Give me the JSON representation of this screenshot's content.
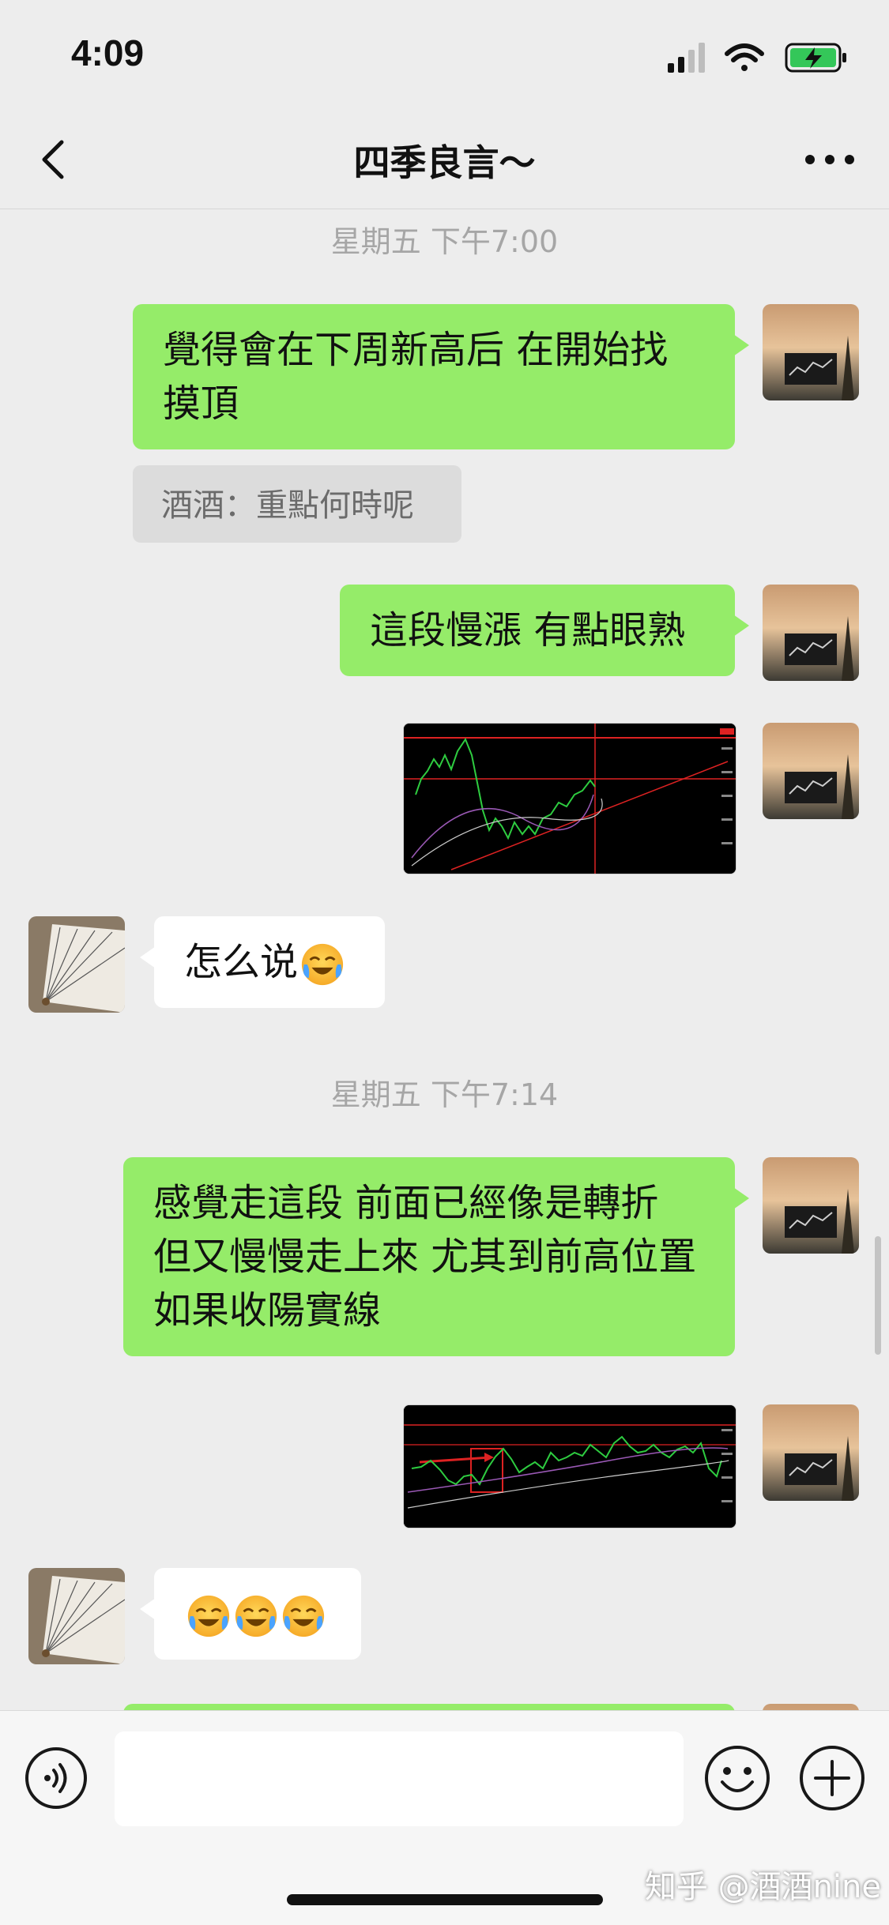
{
  "status": {
    "time": "4:09"
  },
  "nav": {
    "title": "四季良言～"
  },
  "messages": {
    "ts1": "星期五 下午7:00",
    "m1": "覺得會在下周新高后 在開始找摸頂",
    "m1_quote": "酒酒：重點何時呢",
    "m2": "這段慢漲 有點眼熟",
    "m4": "怎么说",
    "ts2": "星期五 下午7:14",
    "m5": "感覺走這段 前面已經像是轉折 但又慢慢走上來 尤其到前高位置 如果收陽實線"
  },
  "watermark": "知乎 @酒酒nine",
  "colors": {
    "my_bubble": "#95ec69",
    "other_bubble": "#ffffff",
    "background": "#ededed"
  },
  "icons": [
    "signal-icon",
    "wifi-icon",
    "battery-charging-icon",
    "back-icon",
    "more-icon",
    "voice-icon",
    "emoji-icon",
    "plus-icon",
    "crying-laughing-emoji"
  ]
}
